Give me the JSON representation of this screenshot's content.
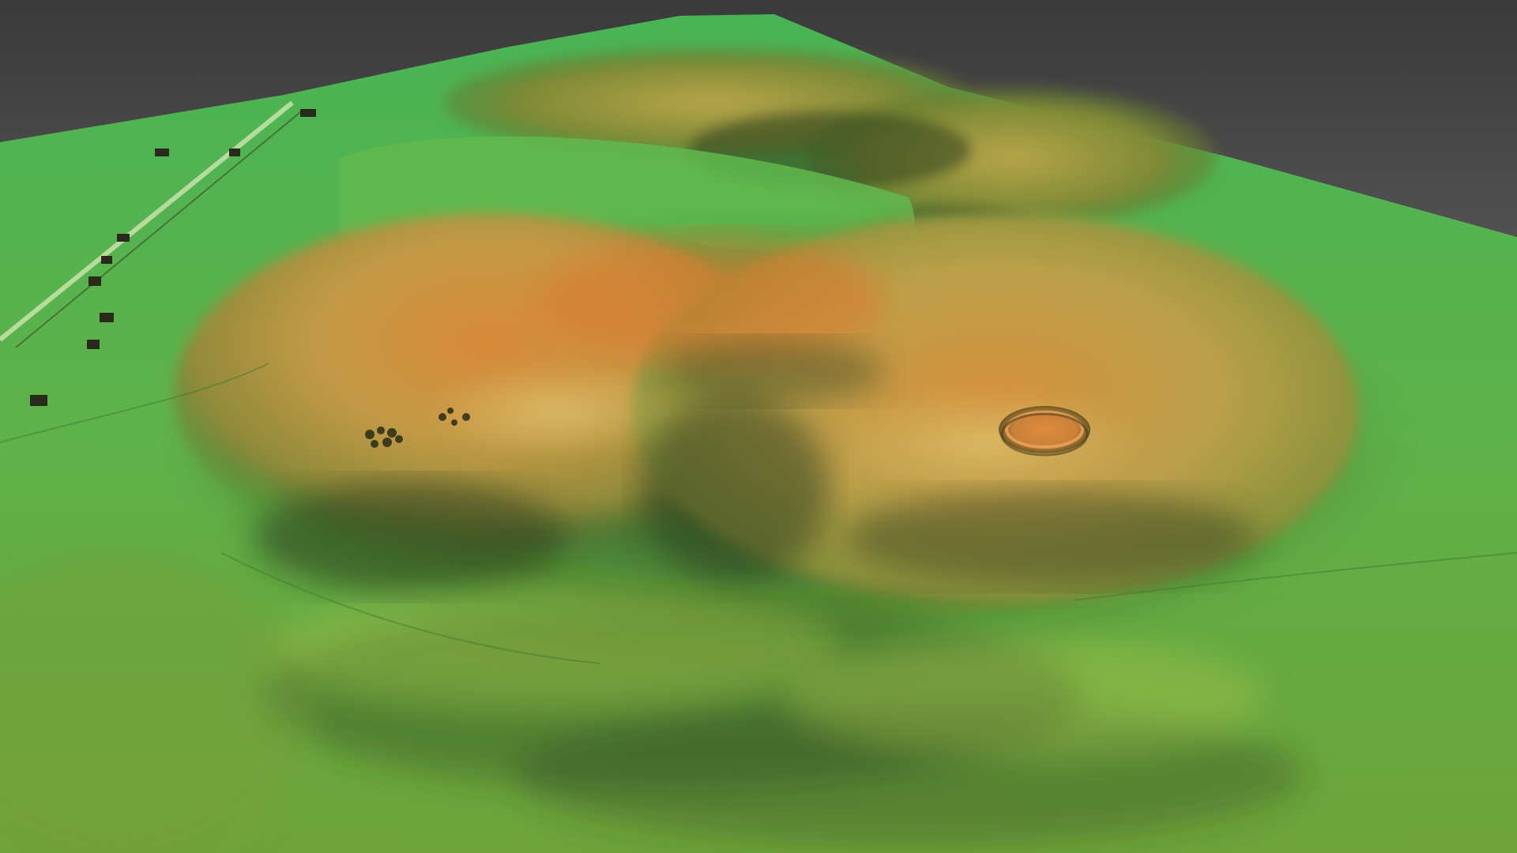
{
  "scene": {
    "subject": "lidar-terrain-relief",
    "colors": {
      "sky_top": "#3a3a3a",
      "sky_bottom": "#8e8e8e",
      "low_elevation": "#3fa84a",
      "mid_elevation": "#9fc24a",
      "high_elevation": "#c98a3a",
      "peak_elevation": "#d9742e",
      "shadow": "#2a3a1e",
      "road": "#cfe6b0"
    }
  }
}
